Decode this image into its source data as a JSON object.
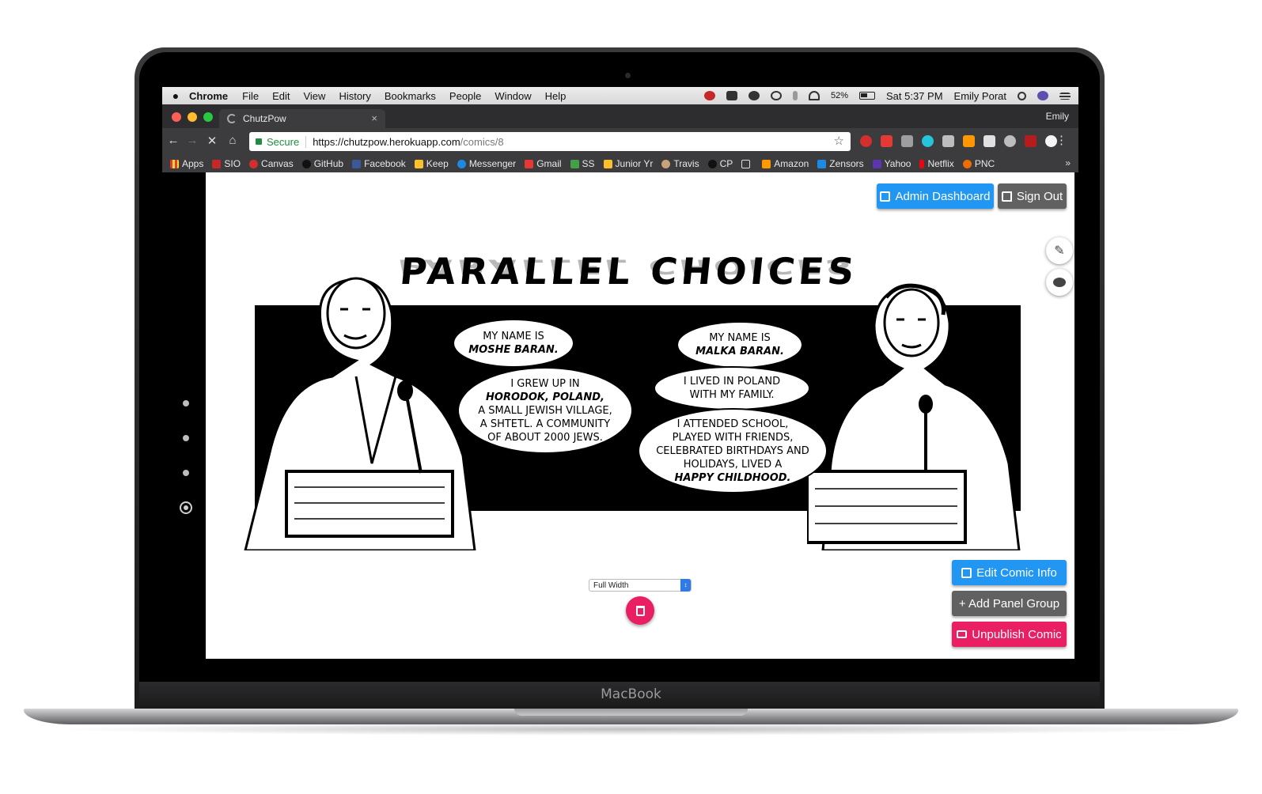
{
  "menubar": {
    "apple": "",
    "app": "Chrome",
    "items": [
      "File",
      "Edit",
      "View",
      "History",
      "Bookmarks",
      "People",
      "Window",
      "Help"
    ],
    "battery": "52%",
    "clock": "Sat 5:37 PM",
    "user": "Emily Porat"
  },
  "browser": {
    "tab_title": "ChutzPow",
    "tab_close": "×",
    "profile": "Emily",
    "secure": "Secure",
    "url_host": "https://chutzpow.herokuapp.com",
    "url_path": "/comics/8",
    "bookmarks": [
      "Apps",
      "SIO",
      "Canvas",
      "GitHub",
      "Facebook",
      "Keep",
      "Messenger",
      "Gmail",
      "SS",
      "Junior Yr",
      "Travis",
      "CP",
      "",
      "Amazon",
      "Zensors",
      "Yahoo",
      "Netflix",
      "PNC"
    ],
    "bookmarks_more": "»"
  },
  "header": {
    "admin_dashboard": "Admin Dashboard",
    "sign_out": "Sign Out"
  },
  "comic": {
    "title": "PARALLEL CHOICES",
    "bubbles": {
      "b1_line1": "MY NAME IS",
      "b1_line2": "MOSHE BARAN.",
      "b2_line1": "I GREW UP IN",
      "b2_line2": "HORODOK, POLAND,",
      "b2_line3": "A SMALL JEWISH VILLAGE,",
      "b2_line4": "A SHTETL. A COMMUNITY",
      "b2_line5": "OF ABOUT 2000 JEWS.",
      "b3_line1": "MY NAME IS",
      "b3_line2": "MALKA BARAN.",
      "b4_line1": "I LIVED IN POLAND",
      "b4_line2": "WITH MY FAMILY.",
      "b5_line1": "I ATTENDED SCHOOL,",
      "b5_line2": "PLAYED WITH FRIENDS,",
      "b5_line3": "CELEBRATED BIRTHDAYS AND",
      "b5_line4": "HOLIDAYS, LIVED A",
      "b5_line5": "HAPPY CHILDHOOD."
    }
  },
  "panel_controls": {
    "width_select": "Full Width"
  },
  "actions": {
    "edit_comic_info": "Edit Comic Info",
    "add_panel_group": "+ Add Panel Group",
    "unpublish_comic": "Unpublish Comic"
  },
  "device": {
    "brand": "MacBook"
  },
  "colors": {
    "primary_blue": "#2196f3",
    "dark_button": "#616161",
    "danger_pink": "#e91e63",
    "secure_green": "#1e8e3e"
  }
}
